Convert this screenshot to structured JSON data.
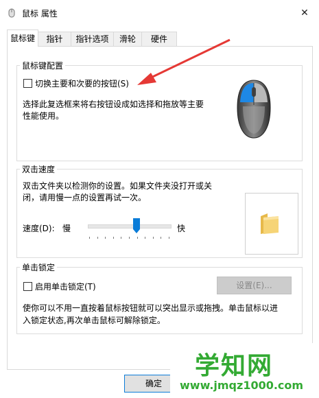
{
  "window": {
    "title": "鼠标 属性",
    "close_glyph": "✕"
  },
  "tabs": [
    {
      "label": "鼠标键"
    },
    {
      "label": "指针"
    },
    {
      "label": "指针选项"
    },
    {
      "label": "滑轮"
    },
    {
      "label": "硬件"
    }
  ],
  "button_config": {
    "legend": "鼠标键配置",
    "checkbox_label": "切换主要和次要的按钮(S)",
    "checked": false,
    "description_line1": "选择此复选框来将右按钮设成如选择和拖放等主要",
    "description_line2": "性能使用。",
    "annotation_color": "#e53935"
  },
  "double_click": {
    "legend": "双击速度",
    "description_line1": "双击文件夹以检测你的设置。如果文件夹没打开或关",
    "description_line2": "闭，请用慢一点的设置再试一次。",
    "speed_label": "速度(D):",
    "slow_label": "慢",
    "fast_label": "快",
    "speed_level": 0.6
  },
  "click_lock": {
    "legend": "单击锁定",
    "checkbox_label": "启用单击锁定(T)",
    "checked": false,
    "settings_button": "设置(E)...",
    "description_line1": "使你可以不用一直按着鼠标按钮就可以突出显示或拖拽。单击鼠标以进",
    "description_line2": "入锁定状态,再次单击鼠标可解除锁定。"
  },
  "footer": {
    "ok_button": "确定"
  },
  "watermark": {
    "main": "学知网",
    "url": "www.jmqz1000.com"
  },
  "colors": {
    "accent": "#0a7cd8",
    "mouse_blue": "#1e88e5",
    "watermark_green": "#33aa33"
  }
}
